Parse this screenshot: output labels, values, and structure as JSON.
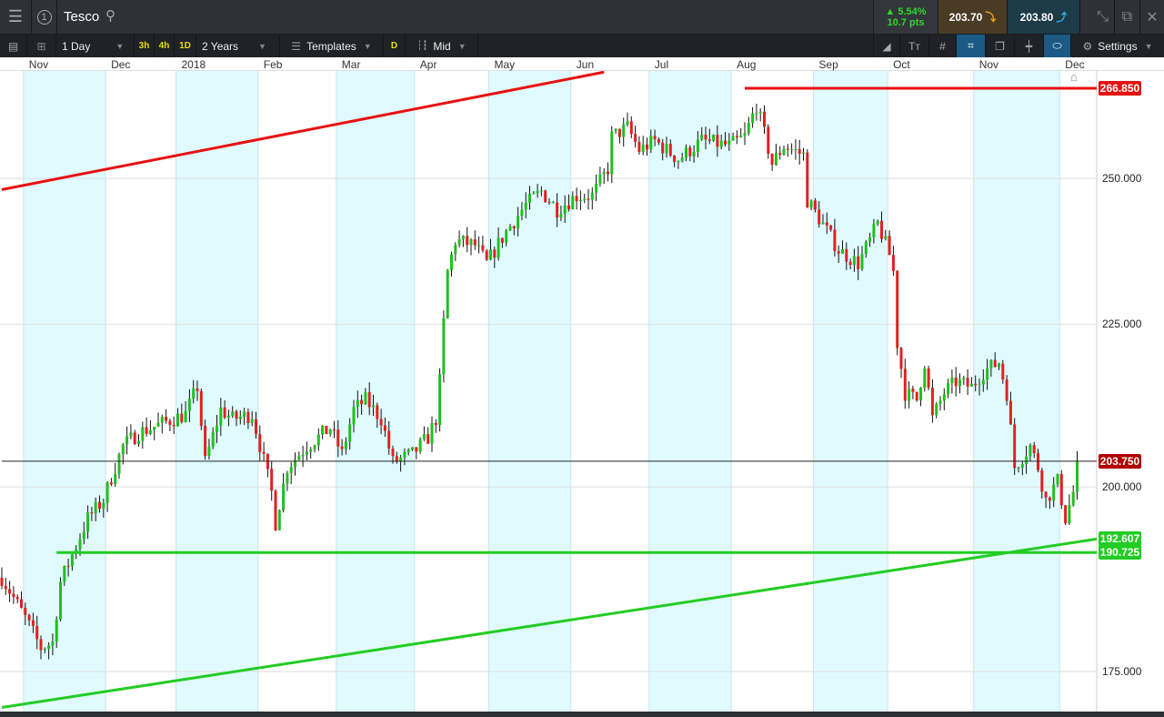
{
  "header": {
    "instrument": "Tesco",
    "alert_count": "1",
    "change_pct": "▲ 5.54%",
    "change_pts": "10.7 pts",
    "sell_price": "203.70",
    "buy_price": "203.80"
  },
  "toolbar": {
    "interval": "1 Day",
    "quick": [
      "3h",
      "4h",
      "1D"
    ],
    "range": "2 Years",
    "templates": "Templates",
    "d_label": "D",
    "price_type": "Mid",
    "settings": "Settings"
  },
  "colors": {
    "up": "#1fc01f",
    "down": "#e02020",
    "shade": "#e0fbff",
    "red_line": "#e81010",
    "green_line": "#22cc22",
    "last_tag": "#b00000"
  },
  "chart_data": {
    "type": "candlestick",
    "scale": "log",
    "ylim": [
      170.0,
      272.9
    ],
    "yticks": [
      {
        "label": "250.000",
        "v": 250
      },
      {
        "label": "225.000",
        "v": 225
      },
      {
        "label": "200.000",
        "v": 200
      },
      {
        "label": "175.000",
        "v": 175
      }
    ],
    "months": [
      {
        "label": "Nov",
        "day": 6
      },
      {
        "label": "Dec",
        "day": 27
      },
      {
        "label": "2018",
        "day": 45
      },
      {
        "label": "Feb",
        "day": 66
      },
      {
        "label": "Mar",
        "day": 86
      },
      {
        "label": "Apr",
        "day": 106
      },
      {
        "label": "May",
        "day": 125
      },
      {
        "label": "Jun",
        "day": 146
      },
      {
        "label": "Jul",
        "day": 166
      },
      {
        "label": "Aug",
        "day": 187
      },
      {
        "label": "Sep",
        "day": 208
      },
      {
        "label": "Oct",
        "day": 227
      },
      {
        "label": "Nov",
        "day": 249
      },
      {
        "label": "Dec",
        "day": 271
      }
    ],
    "path": [
      [
        0,
        187.3
      ],
      [
        6,
        181.9
      ],
      [
        10,
        178.0
      ],
      [
        13,
        178.7
      ],
      [
        15,
        186.7
      ],
      [
        19,
        191.7
      ],
      [
        22,
        195.5
      ],
      [
        26,
        198.1
      ],
      [
        28,
        201.4
      ],
      [
        31,
        206.0
      ],
      [
        35,
        208.0
      ],
      [
        41,
        209.4
      ],
      [
        47,
        210.8
      ],
      [
        50,
        215.0
      ],
      [
        52,
        203.6
      ],
      [
        56,
        211.5
      ],
      [
        59,
        210.1
      ],
      [
        64,
        210.8
      ],
      [
        69,
        199.2
      ],
      [
        70,
        194.9
      ],
      [
        73,
        202.9
      ],
      [
        78,
        206.0
      ],
      [
        84,
        208.7
      ],
      [
        87,
        204.8
      ],
      [
        90,
        211.5
      ],
      [
        93,
        213.0
      ],
      [
        97,
        210.1
      ],
      [
        100,
        203.6
      ],
      [
        105,
        204.8
      ],
      [
        109,
        207.3
      ],
      [
        111,
        210.1
      ],
      [
        112,
        215.8
      ],
      [
        113,
        225.2
      ],
      [
        114,
        233.7
      ],
      [
        116,
        239.0
      ],
      [
        121,
        238.2
      ],
      [
        124,
        235.1
      ],
      [
        129,
        240.6
      ],
      [
        134,
        245.3
      ],
      [
        138,
        247.7
      ],
      [
        142,
        244.5
      ],
      [
        147,
        246.9
      ],
      [
        151,
        246.9
      ],
      [
        155,
        251.8
      ],
      [
        156,
        257.7
      ],
      [
        160,
        259.4
      ],
      [
        163,
        255.2
      ],
      [
        167,
        256.9
      ],
      [
        173,
        253.5
      ],
      [
        179,
        256.9
      ],
      [
        186,
        256.0
      ],
      [
        190,
        257.7
      ],
      [
        193,
        263.6
      ],
      [
        197,
        252.7
      ],
      [
        200,
        256.0
      ],
      [
        205,
        254.3
      ],
      [
        206,
        246.1
      ],
      [
        209,
        242.9
      ],
      [
        214,
        237.4
      ],
      [
        219,
        235.1
      ],
      [
        222,
        239.0
      ],
      [
        224,
        242.0
      ],
      [
        227,
        236.6
      ],
      [
        228,
        233.7
      ],
      [
        229,
        221.9
      ],
      [
        231,
        214.1
      ],
      [
        234,
        213.0
      ],
      [
        236,
        218.9
      ],
      [
        238,
        210.1
      ],
      [
        241,
        214.1
      ],
      [
        244,
        215.8
      ],
      [
        248,
        215.0
      ],
      [
        251,
        217.4
      ],
      [
        255,
        218.9
      ],
      [
        257,
        214.1
      ],
      [
        259,
        202.9
      ],
      [
        263,
        206.0
      ],
      [
        265,
        202.9
      ],
      [
        267,
        198.1
      ],
      [
        270,
        200.8
      ],
      [
        272,
        195.5
      ],
      [
        274,
        199.2
      ],
      [
        275,
        203.75
      ]
    ],
    "lines": [
      {
        "name": "resistance-horizontal",
        "color": "red",
        "from": [
          190,
          266.85
        ],
        "to": [
          280,
          266.85
        ],
        "label": "266.850"
      },
      {
        "name": "resistance-trend",
        "color": "red",
        "from": [
          0,
          248.0
        ],
        "to": [
          154,
          270.0
        ]
      },
      {
        "name": "support-horizontal",
        "color": "green",
        "from": [
          14,
          190.725
        ],
        "to": [
          280,
          190.725
        ],
        "label": "190.725"
      },
      {
        "name": "support-trend",
        "color": "green",
        "from": [
          0,
          170.5
        ],
        "to": [
          280,
          192.607
        ],
        "label": "192.607"
      },
      {
        "name": "last-price",
        "color": "black",
        "from": [
          0,
          203.75
        ],
        "to": [
          280,
          203.75
        ],
        "label": "203.750"
      }
    ]
  }
}
